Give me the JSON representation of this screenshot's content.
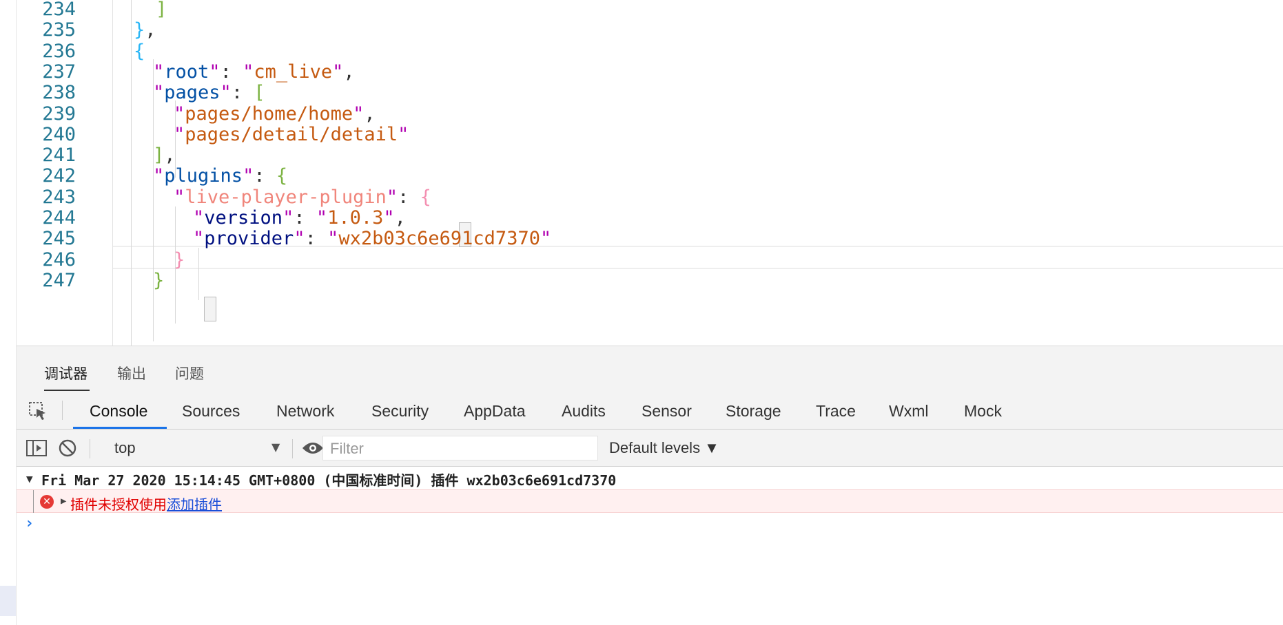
{
  "editor": {
    "lines": [
      {
        "num": "234",
        "parts": [
          {
            "t": "]",
            "c": "c-yellow"
          }
        ]
      },
      {
        "num": "235",
        "parts": [
          {
            "t": "}",
            "c": "c-blue"
          },
          {
            "t": ",",
            "c": "c-dark"
          }
        ]
      },
      {
        "num": "236",
        "parts": [
          {
            "t": "{",
            "c": "c-blue"
          }
        ]
      },
      {
        "num": "237",
        "parts": [
          {
            "t": "\"",
            "c": "q"
          },
          {
            "t": "root",
            "c": "t-key"
          },
          {
            "t": "\"",
            "c": "q"
          },
          {
            "t": ": ",
            "c": "c-dark"
          },
          {
            "t": "\"",
            "c": "q"
          },
          {
            "t": "cm_live",
            "c": "t-str"
          },
          {
            "t": "\"",
            "c": "q"
          },
          {
            "t": ",",
            "c": "c-dark"
          }
        ]
      },
      {
        "num": "238",
        "parts": [
          {
            "t": "\"",
            "c": "q"
          },
          {
            "t": "pages",
            "c": "t-key"
          },
          {
            "t": "\"",
            "c": "q"
          },
          {
            "t": ": ",
            "c": "c-dark"
          },
          {
            "t": "[",
            "c": "c-yellow"
          }
        ]
      },
      {
        "num": "239",
        "parts": [
          {
            "t": "\"",
            "c": "q"
          },
          {
            "t": "pages/home/home",
            "c": "t-str"
          },
          {
            "t": "\"",
            "c": "q"
          },
          {
            "t": ",",
            "c": "c-dark"
          }
        ]
      },
      {
        "num": "240",
        "parts": [
          {
            "t": "\"",
            "c": "q"
          },
          {
            "t": "pages/detail/detail",
            "c": "t-str"
          },
          {
            "t": "\"",
            "c": "q"
          }
        ]
      },
      {
        "num": "241",
        "parts": [
          {
            "t": "]",
            "c": "c-yellow"
          },
          {
            "t": ",",
            "c": "c-dark"
          }
        ]
      },
      {
        "num": "242",
        "parts": [
          {
            "t": "\"",
            "c": "q"
          },
          {
            "t": "plugins",
            "c": "t-key"
          },
          {
            "t": "\"",
            "c": "q"
          },
          {
            "t": ": ",
            "c": "c-dark"
          },
          {
            "t": "{",
            "c": "c-yellow"
          }
        ]
      },
      {
        "num": "243",
        "parts": [
          {
            "t": "\"",
            "c": "q"
          },
          {
            "t": "live-player-plugin",
            "c": "t-pluginkey"
          },
          {
            "t": "\"",
            "c": "q"
          },
          {
            "t": ": ",
            "c": "c-dark"
          },
          {
            "t": "{",
            "c": "c-pink"
          }
        ]
      },
      {
        "num": "244",
        "parts": [
          {
            "t": "\"",
            "c": "q"
          },
          {
            "t": "version",
            "c": "t-key2"
          },
          {
            "t": "\"",
            "c": "q"
          },
          {
            "t": ": ",
            "c": "c-dark"
          },
          {
            "t": "\"",
            "c": "q"
          },
          {
            "t": "1.0.3",
            "c": "t-str"
          },
          {
            "t": "\"",
            "c": "q"
          },
          {
            "t": ",",
            "c": "c-dark"
          }
        ]
      },
      {
        "num": "245",
        "parts": [
          {
            "t": "\"",
            "c": "q"
          },
          {
            "t": "provider",
            "c": "t-key2"
          },
          {
            "t": "\"",
            "c": "q"
          },
          {
            "t": ": ",
            "c": "c-dark"
          },
          {
            "t": "\"",
            "c": "q"
          },
          {
            "t": "wx2b03c6e691cd7370",
            "c": "t-str"
          },
          {
            "t": "\"",
            "c": "q"
          }
        ]
      },
      {
        "num": "246",
        "parts": [
          {
            "t": "}",
            "c": "c-pink"
          }
        ]
      },
      {
        "num": "247",
        "parts": [
          {
            "t": "}",
            "c": "c-yellow"
          }
        ]
      }
    ]
  },
  "panel": {
    "tabs": [
      "调试器",
      "输出",
      "问题"
    ]
  },
  "devtools": {
    "tabs": [
      "Console",
      "Sources",
      "Network",
      "Security",
      "AppData",
      "Audits",
      "Sensor",
      "Storage",
      "Trace",
      "Wxml",
      "Mock"
    ]
  },
  "toolbar": {
    "context": "top",
    "filter_placeholder": "Filter",
    "levels": "Default levels ▼"
  },
  "console": {
    "group_header": "Fri Mar 27 2020 15:14:45 GMT+0800 (中国标准时间) 插件 wx2b03c6e691cd7370",
    "error_message": "插件未授权使用",
    "error_link": "添加插件",
    "prompt": "›"
  },
  "colors": {
    "accent": "#1a73e8",
    "error": "#e53935",
    "error_bg": "#fff0f0"
  }
}
